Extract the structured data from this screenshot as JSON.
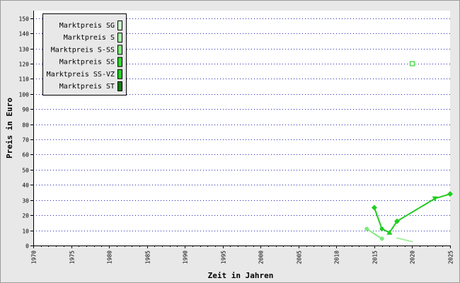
{
  "chart_data": {
    "type": "line",
    "title": "",
    "xlabel": "Zeit in Jahren",
    "ylabel": "Preis in Euro",
    "xlim": [
      1970,
      2025
    ],
    "ylim": [
      0,
      155
    ],
    "x_ticks": [
      1970,
      1975,
      1980,
      1985,
      1990,
      1995,
      2000,
      2005,
      2010,
      2015,
      2020,
      2025
    ],
    "y_ticks": [
      0,
      10,
      20,
      30,
      40,
      50,
      60,
      70,
      80,
      90,
      100,
      110,
      120,
      130,
      140,
      150
    ],
    "grid": true,
    "legend_position": "top-left",
    "series": [
      {
        "name": "Marktpreis SG",
        "color": "#c8f5c8",
        "marker": "none",
        "points": []
      },
      {
        "name": "Marktpreis S",
        "color": "#a6eea6",
        "marker": "none",
        "points": [
          [
            2018,
            5
          ],
          [
            2020,
            2.5
          ]
        ]
      },
      {
        "name": "Marktpreis S-SS",
        "color": "#7ee87e",
        "marker": "circle",
        "points": [
          [
            2014,
            11
          ],
          [
            2016,
            4.5
          ]
        ]
      },
      {
        "name": "Marktpreis SS",
        "color": "#2fd52f",
        "marker": "open-square",
        "points": [
          [
            2020,
            120
          ]
        ]
      },
      {
        "name": "Marktpreis SS-VZ",
        "color": "#22cc22",
        "marker": "mixed",
        "points": [
          [
            2015,
            25
          ],
          [
            2016,
            11
          ],
          [
            2017,
            8.5
          ],
          [
            2018,
            16
          ],
          [
            2023,
            31
          ],
          [
            2025,
            34
          ]
        ]
      },
      {
        "name": "Marktpreis ST",
        "color": "#0f7a0f",
        "marker": "none",
        "points": []
      }
    ]
  }
}
